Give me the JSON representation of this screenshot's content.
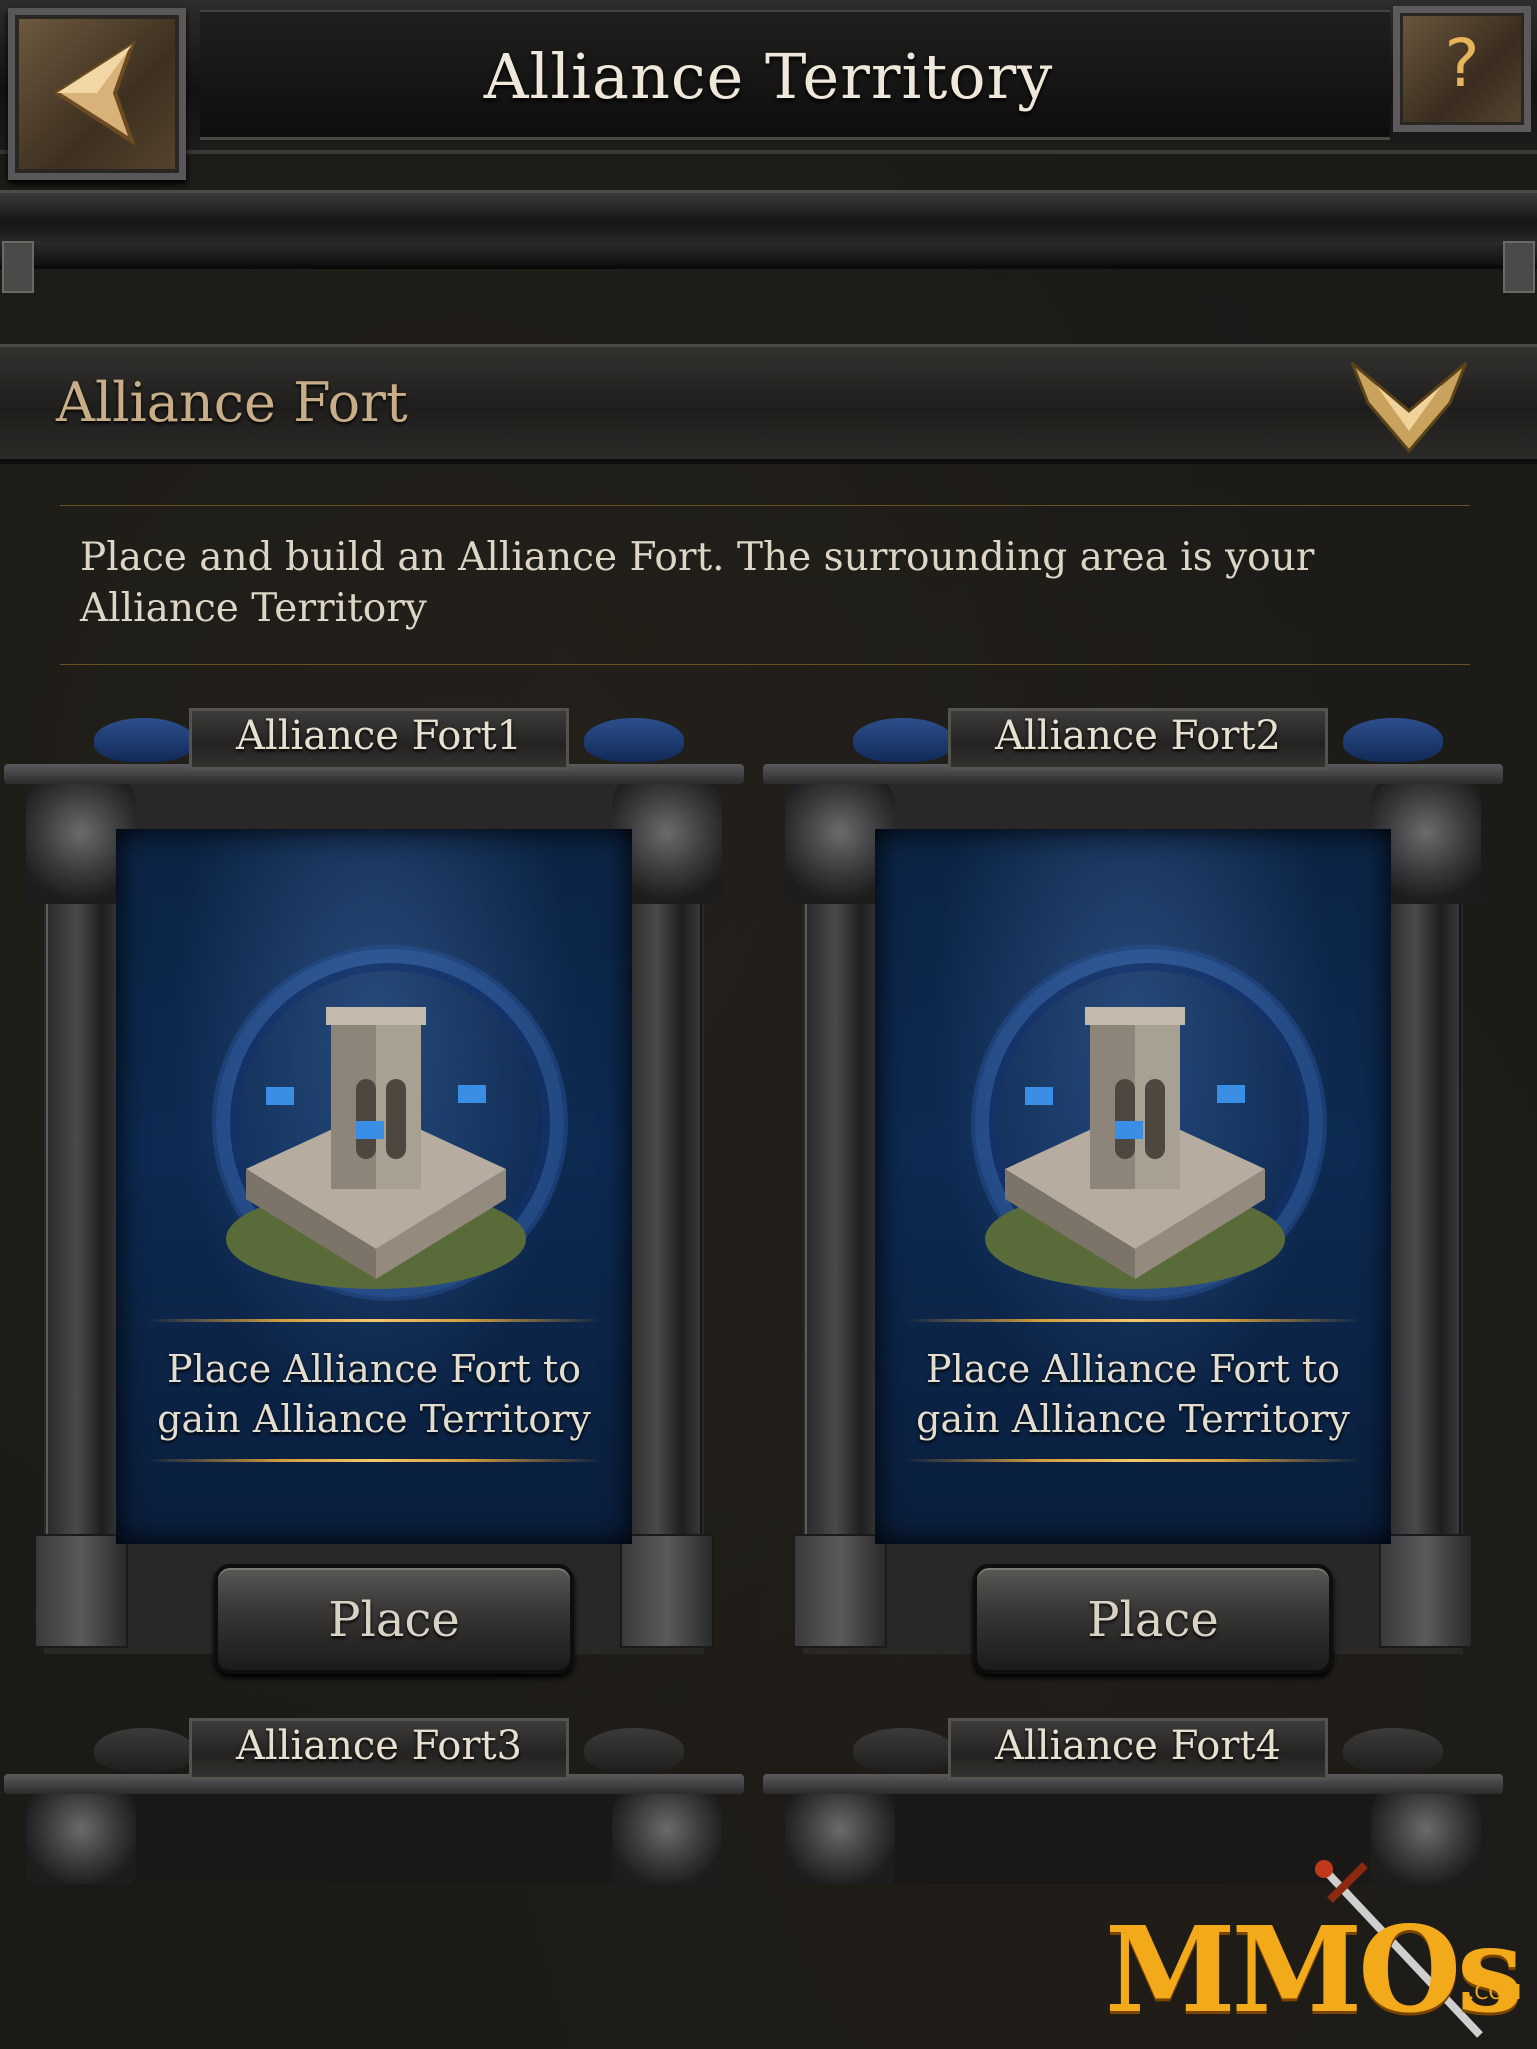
{
  "header": {
    "title": "Alliance Territory",
    "help_label": "?"
  },
  "section": {
    "title": "Alliance Fort",
    "description": "Place and build an Alliance Fort. The surrounding area is your Alliance Territory"
  },
  "forts": [
    {
      "name": "Alliance Fort1",
      "status_line1": "Place Alliance Fort to",
      "status_line2": "gain Alliance Territory",
      "button": "Place"
    },
    {
      "name": "Alliance Fort2",
      "status_line1": "Place Alliance Fort to",
      "status_line2": "gain Alliance Territory",
      "button": "Place"
    },
    {
      "name": "Alliance Fort3"
    },
    {
      "name": "Alliance Fort4"
    }
  ],
  "watermark": {
    "text": "MMOs",
    "suffix": ".COM"
  },
  "colors": {
    "accent_gold": "#d49d3c",
    "panel_blue": "#0d2a52",
    "logo_orange": "#f2a91a"
  },
  "icons": {
    "back": "back-arrow-icon",
    "help": "question-mark-icon",
    "expand": "chevron-down-icon"
  }
}
